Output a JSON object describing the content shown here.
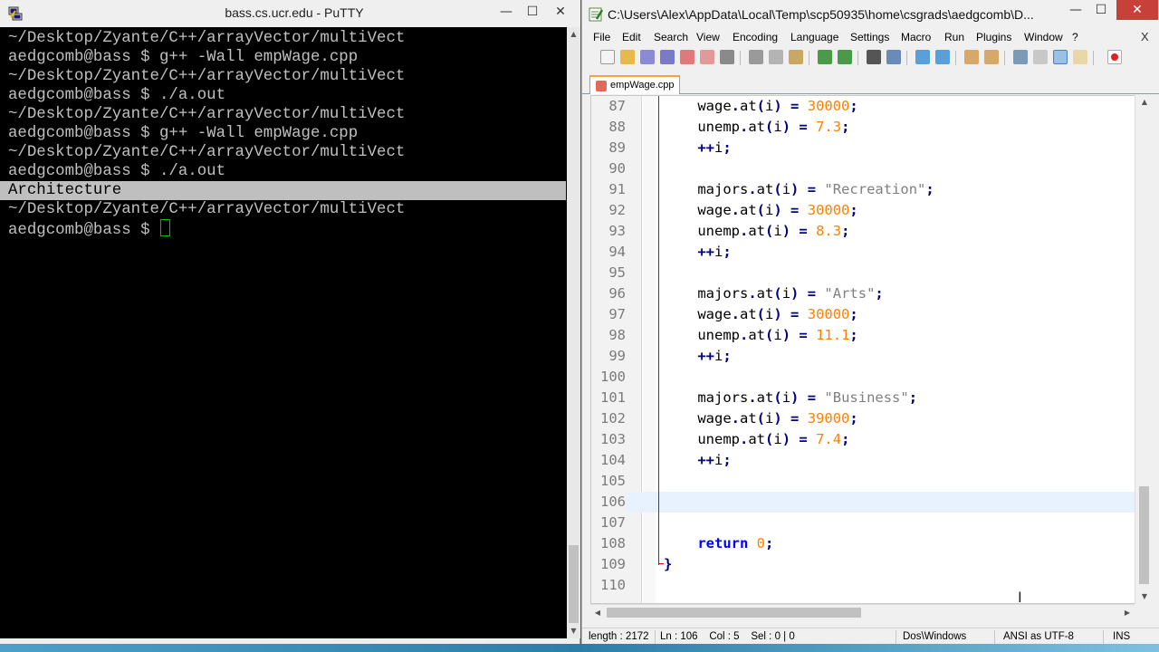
{
  "putty": {
    "title": "bass.cs.ucr.edu - PuTTY",
    "icon": "putty-icon",
    "terminal_lines": [
      "~/Desktop/Zyante/C++/arrayVector/multiVect",
      "aedgcomb@bass $ g++ -Wall empWage.cpp",
      "~/Desktop/Zyante/C++/arrayVector/multiVect",
      "aedgcomb@bass $ ./a.out",
      "~/Desktop/Zyante/C++/arrayVector/multiVect",
      "aedgcomb@bass $ g++ -Wall empWage.cpp",
      "~/Desktop/Zyante/C++/arrayVector/multiVect",
      "aedgcomb@bass $ ./a.out",
      "Architecture",
      "~/Desktop/Zyante/C++/arrayVector/multiVect",
      "aedgcomb@bass $ "
    ],
    "selected_line_index": 8,
    "minimize": "—",
    "maximize": "☐",
    "close": "✕"
  },
  "npp": {
    "title": "C:\\Users\\Alex\\AppData\\Local\\Temp\\scp50935\\home\\csgrads\\aedgcomb\\D...",
    "minimize": "—",
    "maximize": "☐",
    "close": "✕",
    "menu": [
      "File",
      "Edit",
      "Search",
      "View",
      "Encoding",
      "Language",
      "Settings",
      "Macro",
      "Run",
      "Plugins",
      "Window",
      "?"
    ],
    "menu_close": "X",
    "tab_label": "empWage.cpp",
    "active_line": 106,
    "code_lines": [
      {
        "n": "87",
        "html": "    wage<span class=\"op\">.</span>at<span class=\"op\">(</span>i<span class=\"op\">)</span> <span class=\"op\">=</span> <span class=\"num\">30000</span><span class=\"op\">;</span>"
      },
      {
        "n": "88",
        "html": "    unemp<span class=\"op\">.</span>at<span class=\"op\">(</span>i<span class=\"op\">)</span> <span class=\"op\">=</span> <span class=\"num\">7.3</span><span class=\"op\">;</span>"
      },
      {
        "n": "89",
        "html": "    <span class=\"op\">++</span>i<span class=\"op\">;</span>"
      },
      {
        "n": "90",
        "html": ""
      },
      {
        "n": "91",
        "html": "    majors<span class=\"op\">.</span>at<span class=\"op\">(</span>i<span class=\"op\">)</span> <span class=\"op\">=</span> <span class=\"str\">\"Recreation\"</span><span class=\"op\">;</span>"
      },
      {
        "n": "92",
        "html": "    wage<span class=\"op\">.</span>at<span class=\"op\">(</span>i<span class=\"op\">)</span> <span class=\"op\">=</span> <span class=\"num\">30000</span><span class=\"op\">;</span>"
      },
      {
        "n": "93",
        "html": "    unemp<span class=\"op\">.</span>at<span class=\"op\">(</span>i<span class=\"op\">)</span> <span class=\"op\">=</span> <span class=\"num\">8.3</span><span class=\"op\">;</span>"
      },
      {
        "n": "94",
        "html": "    <span class=\"op\">++</span>i<span class=\"op\">;</span>"
      },
      {
        "n": "95",
        "html": ""
      },
      {
        "n": "96",
        "html": "    majors<span class=\"op\">.</span>at<span class=\"op\">(</span>i<span class=\"op\">)</span> <span class=\"op\">=</span> <span class=\"str\">\"Arts\"</span><span class=\"op\">;</span>"
      },
      {
        "n": "97",
        "html": "    wage<span class=\"op\">.</span>at<span class=\"op\">(</span>i<span class=\"op\">)</span> <span class=\"op\">=</span> <span class=\"num\">30000</span><span class=\"op\">;</span>"
      },
      {
        "n": "98",
        "html": "    unemp<span class=\"op\">.</span>at<span class=\"op\">(</span>i<span class=\"op\">)</span> <span class=\"op\">=</span> <span class=\"num\">11.1</span><span class=\"op\">;</span>"
      },
      {
        "n": "99",
        "html": "    <span class=\"op\">++</span>i<span class=\"op\">;</span>"
      },
      {
        "n": "100",
        "html": ""
      },
      {
        "n": "101",
        "html": "    majors<span class=\"op\">.</span>at<span class=\"op\">(</span>i<span class=\"op\">)</span> <span class=\"op\">=</span> <span class=\"str\">\"Business\"</span><span class=\"op\">;</span>"
      },
      {
        "n": "102",
        "html": "    wage<span class=\"op\">.</span>at<span class=\"op\">(</span>i<span class=\"op\">)</span> <span class=\"op\">=</span> <span class=\"num\">39000</span><span class=\"op\">;</span>"
      },
      {
        "n": "103",
        "html": "    unemp<span class=\"op\">.</span>at<span class=\"op\">(</span>i<span class=\"op\">)</span> <span class=\"op\">=</span> <span class=\"num\">7.4</span><span class=\"op\">;</span>"
      },
      {
        "n": "104",
        "html": "    <span class=\"op\">++</span>i<span class=\"op\">;</span>"
      },
      {
        "n": "105",
        "html": ""
      },
      {
        "n": "106",
        "html": ""
      },
      {
        "n": "107",
        "html": ""
      },
      {
        "n": "108",
        "html": "    <span class=\"kw\">return</span> <span class=\"num\">0</span><span class=\"op\">;</span>"
      },
      {
        "n": "109",
        "html": "<span class=\"op\">}</span>"
      },
      {
        "n": "110",
        "html": ""
      }
    ],
    "status": {
      "length": "length : 2172",
      "position": "Ln : 106    Col : 5    Sel : 0 | 0",
      "eol": "Dos\\Windows",
      "encoding": "ANSI as UTF-8",
      "mode": "INS"
    },
    "colors": {
      "keyword": "#0000ff",
      "number": "#ff8000",
      "string": "#808080",
      "operator": "#000080",
      "fold_line": "#e20000",
      "active_line_bg": "#e8f2fe"
    }
  }
}
